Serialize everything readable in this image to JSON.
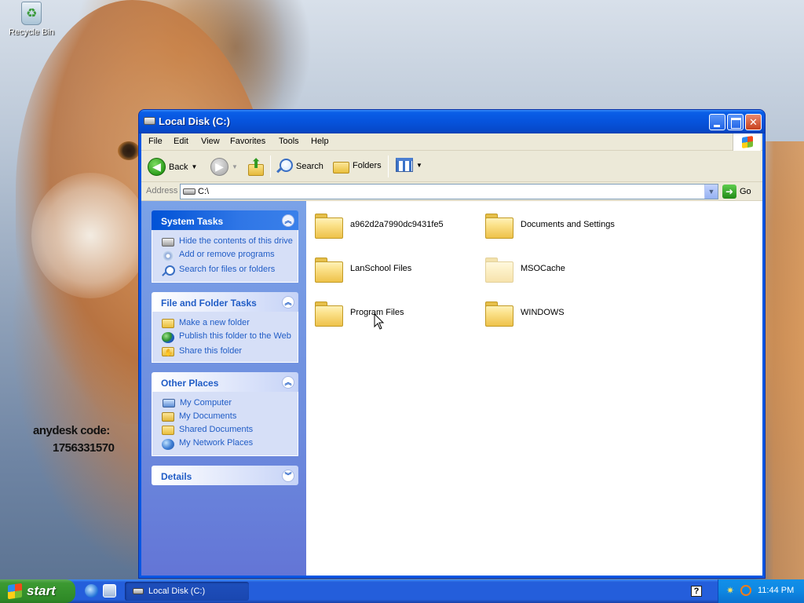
{
  "desktop": {
    "recycle_bin_label": "Recycle Bin",
    "anydesk_line1": "anydesk code:",
    "anydesk_line2": "1756331570"
  },
  "window": {
    "title": "Local Disk (C:)",
    "menu": [
      "File",
      "Edit",
      "View",
      "Favorites",
      "Tools",
      "Help"
    ],
    "toolbar": {
      "back_label": "Back",
      "search_label": "Search",
      "folders_label": "Folders"
    },
    "address": {
      "label": "Address",
      "value": "C:\\",
      "go_label": "Go"
    }
  },
  "taskpane": {
    "system_tasks": {
      "title": "System Tasks",
      "items": [
        "Hide the contents of this drive",
        "Add or remove programs",
        "Search for files or folders"
      ]
    },
    "file_folder_tasks": {
      "title": "File and Folder Tasks",
      "items": [
        "Make a new folder",
        "Publish this folder to the Web",
        "Share this folder"
      ]
    },
    "other_places": {
      "title": "Other Places",
      "items": [
        "My Computer",
        "My Documents",
        "Shared Documents",
        "My Network Places"
      ]
    },
    "details": {
      "title": "Details"
    }
  },
  "files": [
    {
      "name": "a962d2a7990dc9431fe5",
      "hidden": false
    },
    {
      "name": "Documents and Settings",
      "hidden": false
    },
    {
      "name": "LanSchool Files",
      "hidden": false
    },
    {
      "name": "MSOCache",
      "hidden": true
    },
    {
      "name": "Program Files",
      "hidden": false
    },
    {
      "name": "WINDOWS",
      "hidden": false
    }
  ],
  "taskbar": {
    "start_label": "start",
    "task_label": "Local Disk (C:)",
    "clock": "11:44 PM"
  },
  "colors": {
    "title_blue": "#0653dc",
    "taskpane_blue": "#6d8cde",
    "link_blue": "#215dc6",
    "start_green": "#3c9a32"
  }
}
